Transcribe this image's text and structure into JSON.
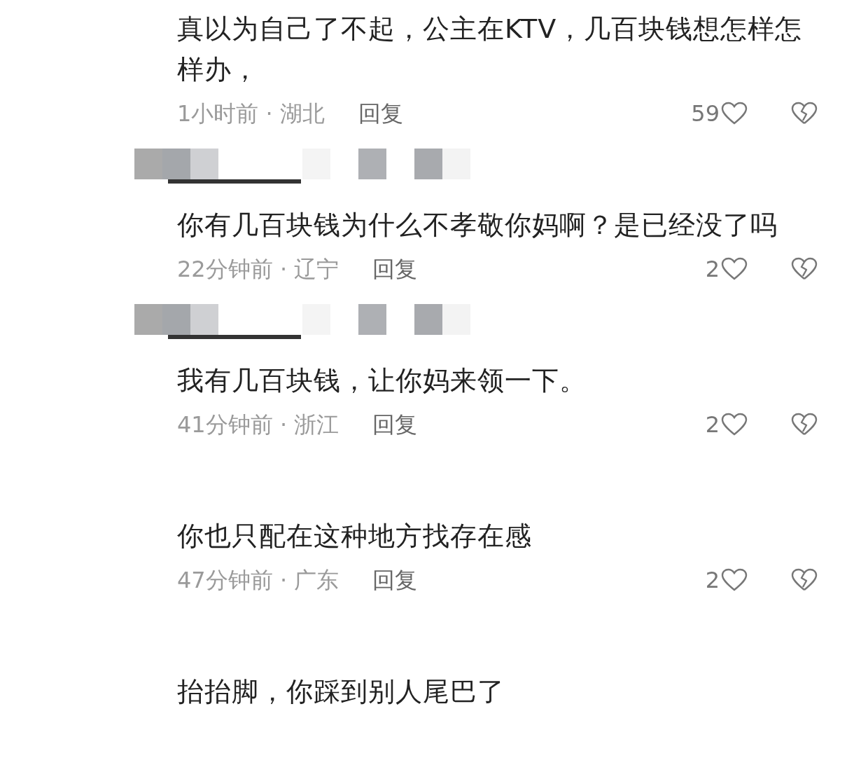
{
  "comments": [
    {
      "text": "真以为自己了不起，公主在KTV，几百块钱想怎样怎样办，",
      "meta": "1小时前 · 湖北",
      "reply": "回复",
      "likes": "59",
      "name_redacted": true
    },
    {
      "text": "你有几百块钱为什么不孝敬你妈啊？是已经没了吗",
      "meta": "22分钟前 · 辽宁",
      "reply": "回复",
      "likes": "2",
      "name_redacted": true
    },
    {
      "text": "我有几百块钱，让你妈来领一下。",
      "meta": "41分钟前 · 浙江",
      "reply": "回复",
      "likes": "2",
      "name_redacted": false
    },
    {
      "text": "你也只配在这种地方找存在感",
      "meta": "47分钟前 · 广东",
      "reply": "回复",
      "likes": "2",
      "name_redacted": false
    },
    {
      "text": "抬抬脚，你踩到别人尾巴了"
    }
  ]
}
